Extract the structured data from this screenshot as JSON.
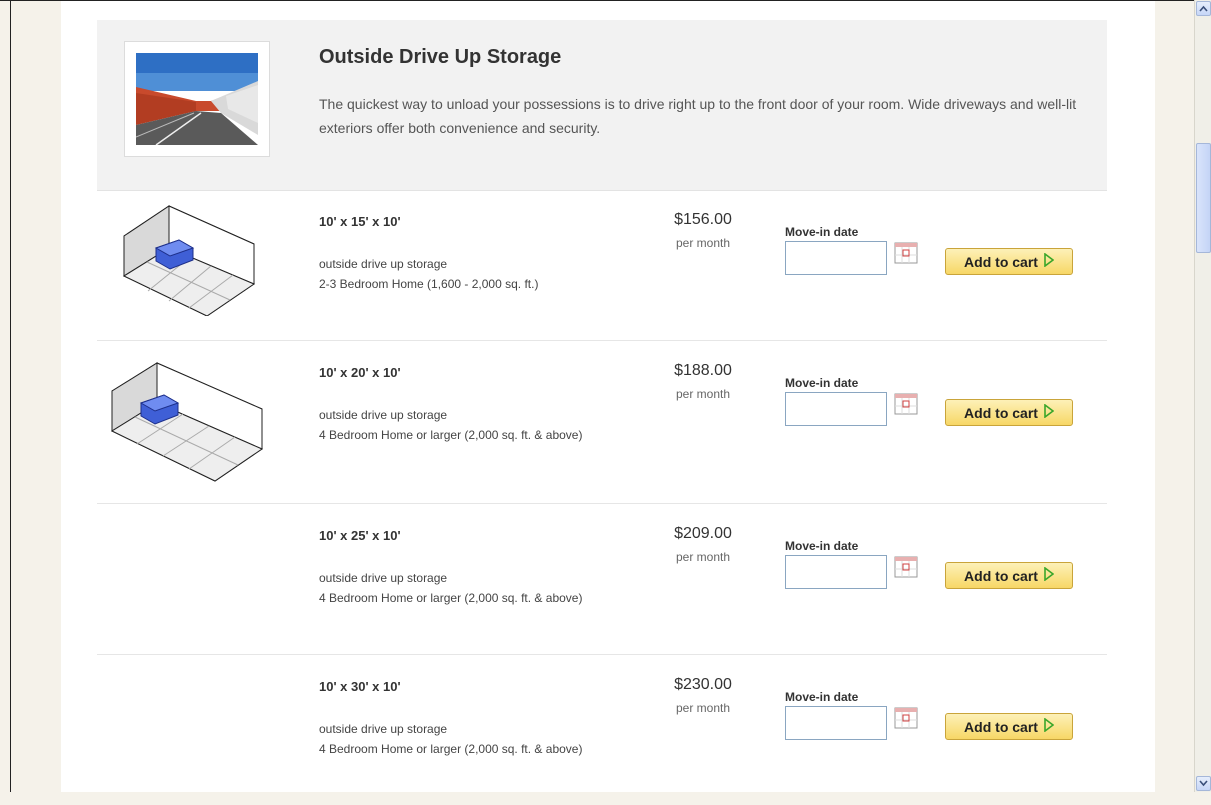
{
  "header": {
    "title": "Outside Drive Up Storage",
    "description": "The quickest way to unload your possessions is to drive right up to the front door of your room. Wide driveways and well-lit exteriors offer both convenience and security."
  },
  "units": [
    {
      "size": "10' x 15' x 10'",
      "type": "outside drive up storage",
      "description": "2-3 Bedroom Home (1,600 - 2,000 sq. ft.)",
      "price": "$156.00",
      "per": "per month",
      "movein_label": "Move-in date",
      "movein_value": "",
      "cart_label": "Add to cart"
    },
    {
      "size": "10' x 20' x 10'",
      "type": "outside drive up storage",
      "description": "4 Bedroom Home or larger (2,000 sq. ft. & above)",
      "price": "$188.00",
      "per": "per month",
      "movein_label": "Move-in date",
      "movein_value": "",
      "cart_label": "Add to cart"
    },
    {
      "size": "10' x 25' x 10'",
      "type": "outside drive up storage",
      "description": "4 Bedroom Home or larger (2,000 sq. ft. & above)",
      "price": "$209.00",
      "per": "per month",
      "movein_label": "Move-in date",
      "movein_value": "",
      "cart_label": "Add to cart"
    },
    {
      "size": "10' x 30' x 10'",
      "type": "outside drive up storage",
      "description": "4 Bedroom Home or larger (2,000 sq. ft. & above)",
      "price": "$230.00",
      "per": "per month",
      "movein_label": "Move-in date",
      "movein_value": "",
      "cart_label": "Add to cart"
    }
  ],
  "icons": {
    "calendar": "calendar-icon",
    "cart_arrow": "play-arrow-icon",
    "scroll_up": "scroll-up-icon",
    "scroll_down": "scroll-down-icon"
  },
  "colors": {
    "button_top": "#fdf1b8",
    "button_bottom": "#f7d766",
    "arrow_green": "#3aa62a",
    "header_bg": "#f2f2f2",
    "page_bg": "#f5f2ea"
  }
}
